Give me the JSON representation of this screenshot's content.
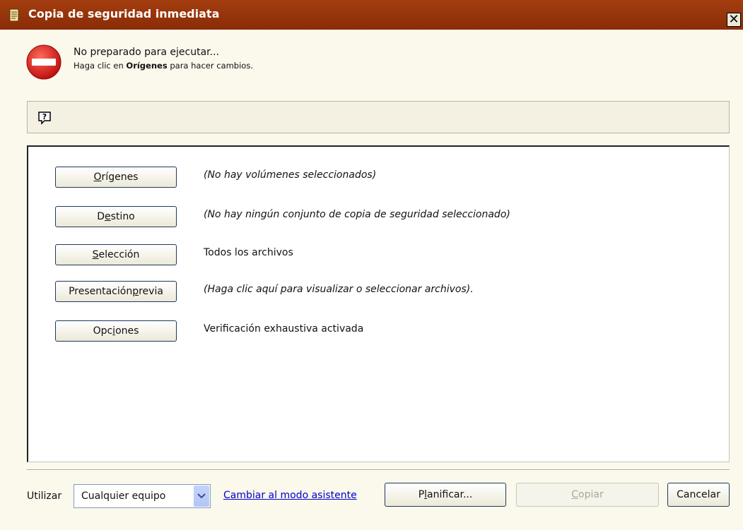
{
  "window": {
    "title": "Copia de seguridad inmediata",
    "close_label": "✕"
  },
  "status": {
    "main": "No preparado para ejecutar...",
    "sub_prefix": "Haga clic en ",
    "sub_bold": "Orígenes",
    "sub_suffix": " para hacer cambios."
  },
  "help": {
    "icon": "help-icon"
  },
  "rows": [
    {
      "label_pre": "",
      "label_u": "O",
      "label_post": "rígenes",
      "description": "(No hay volúmenes seleccionados)",
      "italic": true
    },
    {
      "label_pre": "D",
      "label_u": "e",
      "label_post": "stino",
      "description": "(No hay ningún conjunto de copia de seguridad seleccionado)",
      "italic": true
    },
    {
      "label_pre": "",
      "label_u": "S",
      "label_post": "elección",
      "description": "Todos los archivos",
      "italic": false
    },
    {
      "label_pre": "Presentación ",
      "label_u": "p",
      "label_post": "revia",
      "description": "(Haga clic aquí para visualizar o seleccionar archivos).",
      "italic": true
    },
    {
      "label_pre": "Opc",
      "label_u": "i",
      "label_post": "ones",
      "description": "Verificación exhaustiva activada",
      "italic": false
    }
  ],
  "bottom": {
    "utilizar_label": "Utilizar",
    "combo_value": "Cualquier equipo",
    "wizard_link": "Cambiar al modo asistente",
    "plan_pre": "P",
    "plan_u": "l",
    "plan_post": "anificar...",
    "copy_u": "C",
    "copy_post": "opiar",
    "cancel": "Cancelar"
  },
  "colors": {
    "titlebar": "#9a370c",
    "background": "#fbf8ec",
    "link": "#0000cc",
    "stop_red": "#d8191c"
  }
}
